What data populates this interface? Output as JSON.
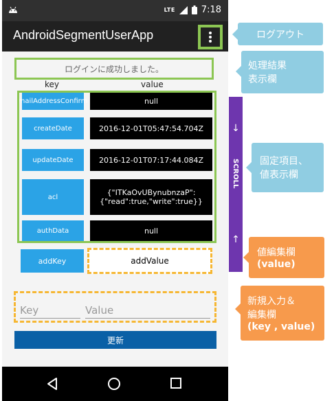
{
  "status_bar": {
    "network": "LTE",
    "time": "7:18"
  },
  "app": {
    "title": "AndroidSegmentUserApp"
  },
  "result": {
    "message": "ログインに成功しました。"
  },
  "table": {
    "key_header": "key",
    "value_header": "value",
    "rows": [
      {
        "key": "mailAddressConfirm",
        "value": "null"
      },
      {
        "key": "createDate",
        "value": "2016-12-01T05:47:54.704Z"
      },
      {
        "key": "updateDate",
        "value": "2016-12-01T07:17:44.084Z"
      },
      {
        "key": "acl",
        "value_line1": "{\"ITKaOvUBynubnzaP\":",
        "value_line2": "{\"read\":true,\"write\":true}}"
      },
      {
        "key": "authData",
        "value": "null"
      }
    ]
  },
  "edit_row": {
    "key_button": "addKey",
    "value": "addValue"
  },
  "new_entry": {
    "key_placeholder": "Key",
    "value_placeholder": "Value"
  },
  "update_button": "更新",
  "scroll": {
    "label": "SCROLL",
    "up_arrow": "↑",
    "down_arrow": "↓"
  },
  "callouts": {
    "logout": "ログアウト",
    "result_line1": "処理結果",
    "result_line2": "表示欄",
    "fixed_line1": "固定項目、",
    "fixed_line2": "値表示欄",
    "edit_line1": "値編集欄",
    "edit_line2": "(value)",
    "new_line1": "新規入力＆",
    "new_line2": "編集欄",
    "new_line3": "(key , value)"
  },
  "colors": {
    "highlight_green": "#8cc653",
    "highlight_orange": "#f6b733",
    "key_blue": "#2ba3e6",
    "update_blue": "#0a60a6",
    "scroll_purple": "#6e36ae",
    "callout_blue": "#90cde2",
    "callout_orange": "#f79a4c"
  },
  "icons": [
    "android-icon",
    "signal-icon",
    "battery-icon",
    "overflow-menu-icon",
    "back-icon",
    "home-icon",
    "recents-icon"
  ]
}
